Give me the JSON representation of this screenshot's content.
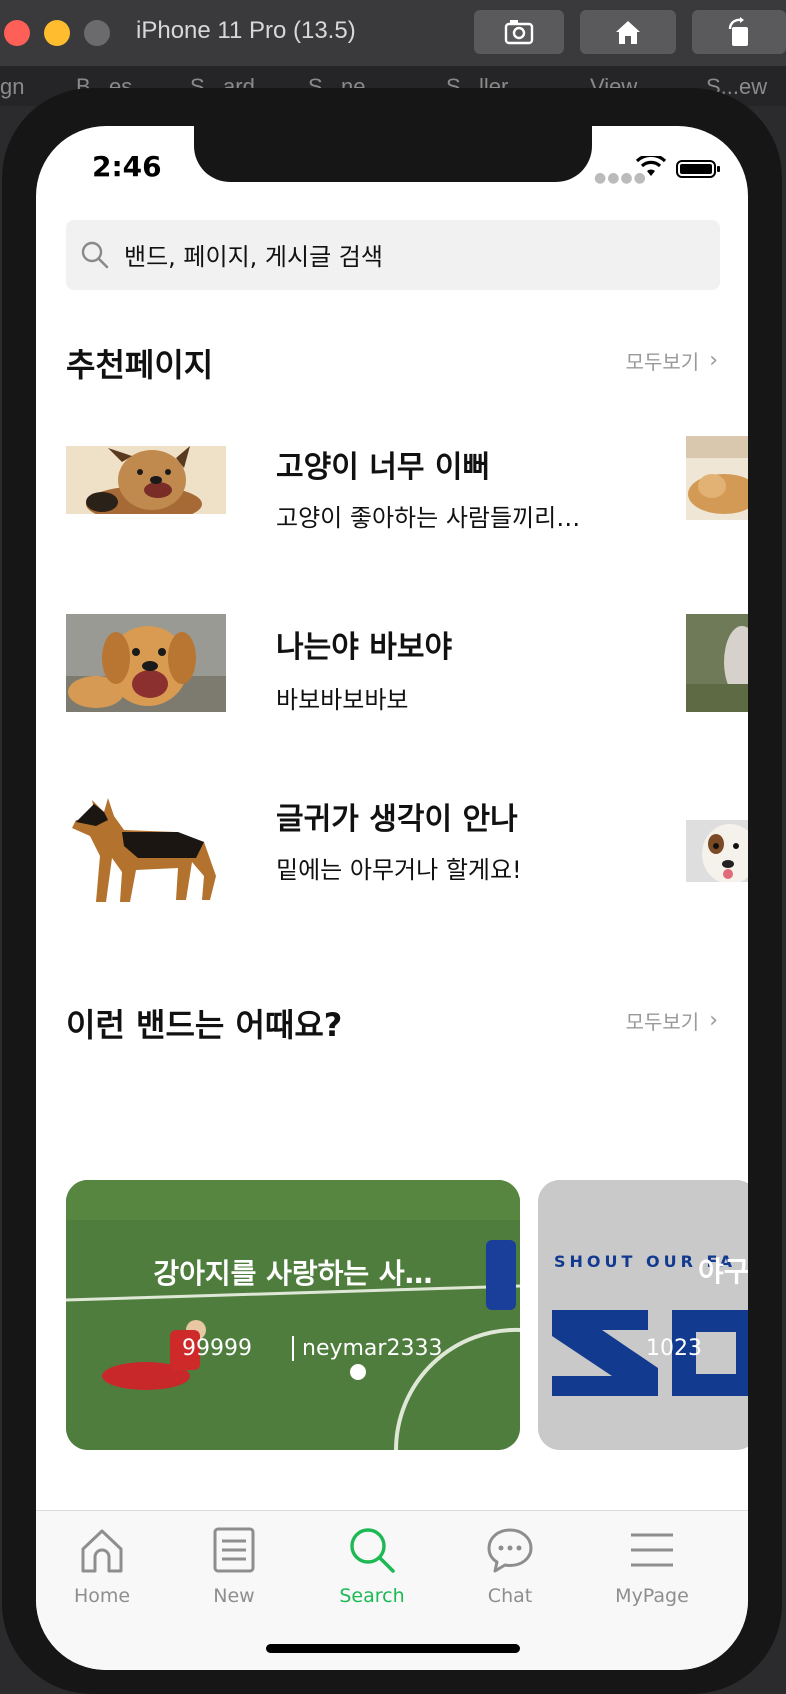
{
  "simulator": {
    "title": "iPhone 11 Pro (13.5)"
  },
  "xcode_breadcrumb": [
    "gn",
    "B...es",
    "S...ard",
    "S...ne",
    "S...ller",
    "View",
    "S...ew"
  ],
  "status_bar": {
    "time": "2:46"
  },
  "search": {
    "placeholder": "밴드, 페이지, 게시글 검색"
  },
  "recommended_pages": {
    "title": "추천페이지",
    "see_all": "모두보기",
    "items": [
      {
        "title": "고양이 너무 이뻐",
        "subtitle": "고양이 좋아하는 사람들끼리…"
      },
      {
        "title": "나는야 바보야",
        "subtitle": "바보바보바보"
      },
      {
        "title": "글귀가 생각이 안나",
        "subtitle": "밑에는 아무거나 할게요!"
      }
    ]
  },
  "band_suggestions": {
    "title": "이런 밴드는 어때요?",
    "see_all": "모두보기",
    "items": [
      {
        "title": "강아지를 사랑하는 사…",
        "members": "99999",
        "owner": "neymar2333"
      },
      {
        "title": "야구",
        "members": "1023",
        "image_text": "SHOUT OUR FA"
      }
    ]
  },
  "tabbar": {
    "items": [
      {
        "label": "Home",
        "icon": "home-icon"
      },
      {
        "label": "New",
        "icon": "list-icon"
      },
      {
        "label": "Search",
        "icon": "search-icon",
        "active": true
      },
      {
        "label": "Chat",
        "icon": "chat-bubble-icon"
      },
      {
        "label": "MyPage",
        "icon": "menu-icon"
      }
    ]
  },
  "colors": {
    "accent": "#1db954",
    "inactive_tab": "#8e8e8e"
  }
}
